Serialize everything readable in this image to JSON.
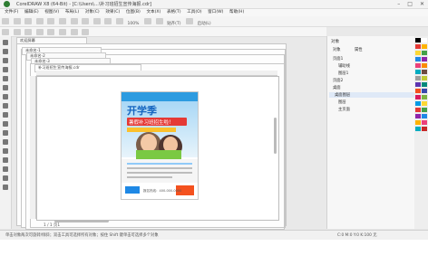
{
  "window": {
    "title": "CorelDRAW X8 (64-Bit) - [C:\\Users\\...\\补习班招生宣传海报.cdr]",
    "controls": [
      "–",
      "□",
      "✕"
    ]
  },
  "menubar": {
    "items": [
      "文件(F)",
      "编辑(E)",
      "视图(V)",
      "布局(L)",
      "对象(C)",
      "效果(C)",
      "位图(B)",
      "文本(X)",
      "表格(T)",
      "工具(O)",
      "窗口(W)",
      "帮助(H)"
    ]
  },
  "toolbar": {
    "zoom": "100%",
    "snap_label": "贴齐(T)",
    "launch_label": "启动(L)"
  },
  "doc_tabs": [
    "欢迎屏幕",
    "未命名-1",
    "未命名-2",
    "未命名-3",
    "补习班招生宣传海报.cdr"
  ],
  "poster": {
    "headline": "开学季",
    "subhead": "暑假补习班招生啦！",
    "badge": "",
    "footer": "报名热线：400-000-0000"
  },
  "right_panel": {
    "header": "对象",
    "tabs": [
      "对象",
      "属性"
    ],
    "items": [
      "页面1",
      "辅助线",
      "图层1",
      "页面2",
      "桌面",
      "桌面图层",
      "图层",
      "主页面"
    ]
  },
  "page_nav": {
    "current": "1",
    "total": "1",
    "label": "页1"
  },
  "statusbar": {
    "left": "单击对象两次可旋转/倾斜；双击工具可选择所有对象；按住 Shift 键单击可选择多个对象",
    "right": "C:0 M:0 Y:0 K:100  无"
  },
  "palette_colors": [
    "#000000",
    "#ffffff",
    "#e53935",
    "#ffb300",
    "#fdd835",
    "#43a047",
    "#1e88e5",
    "#8e24aa",
    "#ec407a",
    "#fb8c00",
    "#00acc1",
    "#6d4c41",
    "#9e9e9e",
    "#c0ca33",
    "#5e35b1",
    "#00897b",
    "#f4511e",
    "#3949ab",
    "#d81b60",
    "#7cb342",
    "#039be5",
    "#fdd835",
    "#e53935",
    "#43a047",
    "#8e24aa",
    "#1e88e5",
    "#ffb300",
    "#ec407a",
    "#00acc1",
    "#c62828"
  ]
}
